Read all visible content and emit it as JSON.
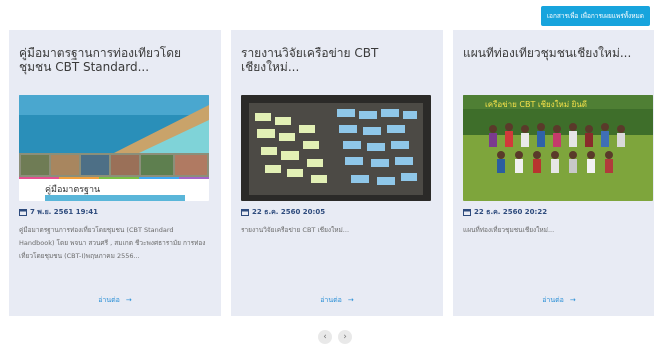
{
  "header": {
    "button_label": "เอกสารเพื่อ เพื่อการเผยแพร่ทั้งหมด"
  },
  "cards": [
    {
      "title": "คู่มือมาตรฐานการท่องเที่ยวโดยชุมชน CBT Standard...",
      "date": "7 พ.ย. 2561 19:41",
      "excerpt": "คู่มือมาตรฐานการท่องเที่ยวโดยชุมชน (CBT Standard Handbook) โดย พจนา สวนศรี , สมเกต ชีวะพงศธารามัย การท่องเที่ยวโดยชุมชน (CBT-I)พฤษภาคม 2556...",
      "thumb_caption": "คู่มือมาตรฐาน",
      "read_more": "อ่านต่อ"
    },
    {
      "title": "รายงานวิจัยเครือข่าย CBT เชียงใหม่...",
      "date": "22 ธ.ค. 2560 20:05",
      "excerpt": "รายงานวิจัยเครือข่าย CBT เชียงใหม่...",
      "read_more": "อ่านต่อ"
    },
    {
      "title": "แผนที่ท่องเที่ยวชุมชนเชียงใหม่...",
      "date": "22 ธ.ค. 2560 20:22",
      "excerpt": "แผนที่ท่องเที่ยวชุมชนเชียงใหม่...",
      "thumb_caption": "เครือข่าย CBT เชียงใหม่ ยินดี",
      "read_more": "อ่านต่อ"
    }
  ],
  "pager": {
    "prev": "‹",
    "next": "›"
  },
  "colors": {
    "accent": "#17a4dd",
    "card_bg": "#e8ebf4",
    "date": "#2e4b7d",
    "link": "#2a8fd6"
  }
}
